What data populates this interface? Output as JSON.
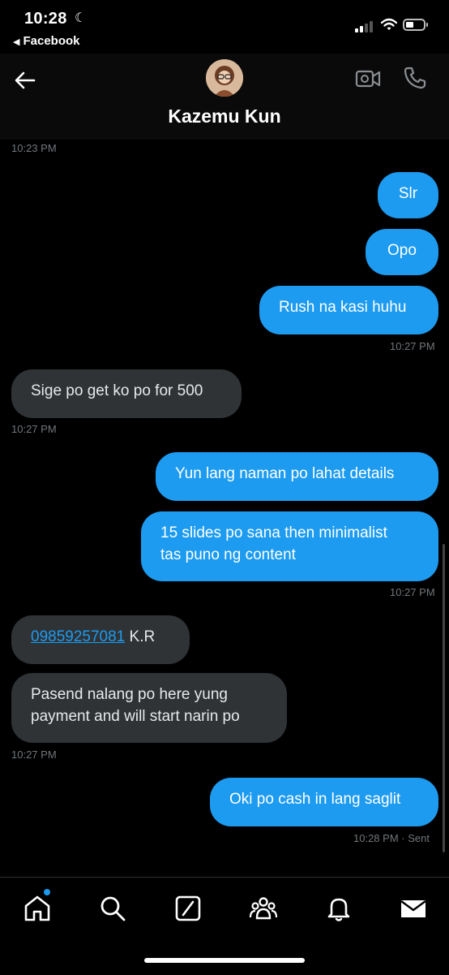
{
  "status_bar": {
    "time": "10:28",
    "back_app": "Facebook"
  },
  "header": {
    "contact_name": "Kazemu Kun",
    "icons": [
      "back-arrow-icon",
      "video-call-icon",
      "phone-icon"
    ]
  },
  "messages": {
    "ts_top": "10:23 PM",
    "m1": "Slr",
    "m2": "Opo",
    "m3": "Rush na kasi huhu",
    "ts1": "10:27 PM",
    "m4": "Sige po get ko po for 500",
    "ts2": "10:27 PM",
    "m5": "Yun lang naman po lahat details",
    "m6_line1": "15 slides po sana then minimalist",
    "m6_line2": "tas puno ng content",
    "ts3": "10:27 PM",
    "m7_link": "09859257081",
    "m7_rest": " K.R",
    "m8_line1": "Pasend nalang po here yung",
    "m8_line2": "payment and will start narin po",
    "ts4": "10:27 PM",
    "m9": "Oki po cash in lang saglit",
    "ts5": "10:28 PM · Sent"
  },
  "bottom_nav": {
    "items": [
      "home-icon",
      "search-icon",
      "grok-icon",
      "communities-icon",
      "notifications-icon",
      "messages-icon"
    ]
  },
  "colors": {
    "outgoing_bubble": "#1d9bf0",
    "incoming_bubble": "#2f3336",
    "background": "#000000",
    "timestamp": "#71767b"
  }
}
